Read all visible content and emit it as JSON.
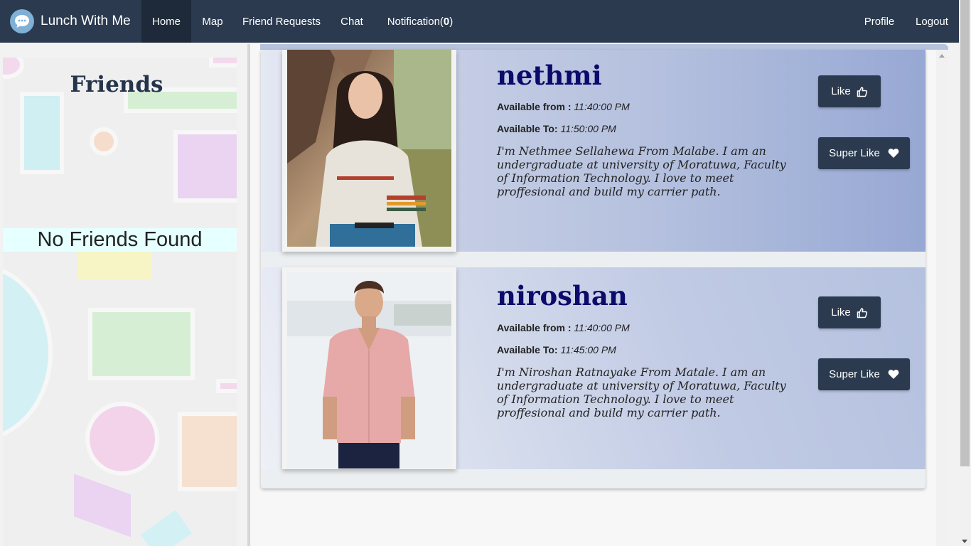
{
  "navbar": {
    "brand": "Lunch With Me",
    "items": [
      {
        "label": "Home",
        "active": true
      },
      {
        "label": "Map"
      },
      {
        "label": "Friend Requests"
      },
      {
        "label": "Chat"
      }
    ],
    "notification_label": "Notification(",
    "notification_count": "0",
    "notification_close": ")",
    "right_items": [
      {
        "label": "Profile"
      },
      {
        "label": "Logout"
      }
    ]
  },
  "sidebar": {
    "title": "Friends",
    "empty_message": "No Friends Found"
  },
  "users": [
    {
      "name": "nethmi",
      "available_from_label": "Available from :",
      "available_from": "11:40:00 PM",
      "available_to_label": "Available To:",
      "available_to": "11:50:00 PM",
      "bio": "I'm Nethmee Sellahewa From Malabe. I am an undergraduate at university of Moratuwa, Faculty of Information Technology. I love to meet proffesional and build my carrier path.",
      "like_label": "Like",
      "super_like_label": "Super Like"
    },
    {
      "name": "niroshan",
      "available_from_label": "Available from :",
      "available_from": "11:40:00 PM",
      "available_to_label": "Available To:",
      "available_to": "11:45:00 PM",
      "bio": "I'm Niroshan Ratnayake From Matale. I am an undergraduate at university of Moratuwa, Faculty of Information Technology. I love to meet proffesional and build my carrier path.",
      "like_label": "Like",
      "super_like_label": "Super Like"
    }
  ],
  "icons": {
    "brand": "chat-bubble-icon",
    "like": "thumbs-up-icon",
    "super_like": "heart-icon"
  },
  "colors": {
    "navbar": "#2b3a4f",
    "name_text": "#0c0a6b",
    "button": "#2b3a4f"
  }
}
